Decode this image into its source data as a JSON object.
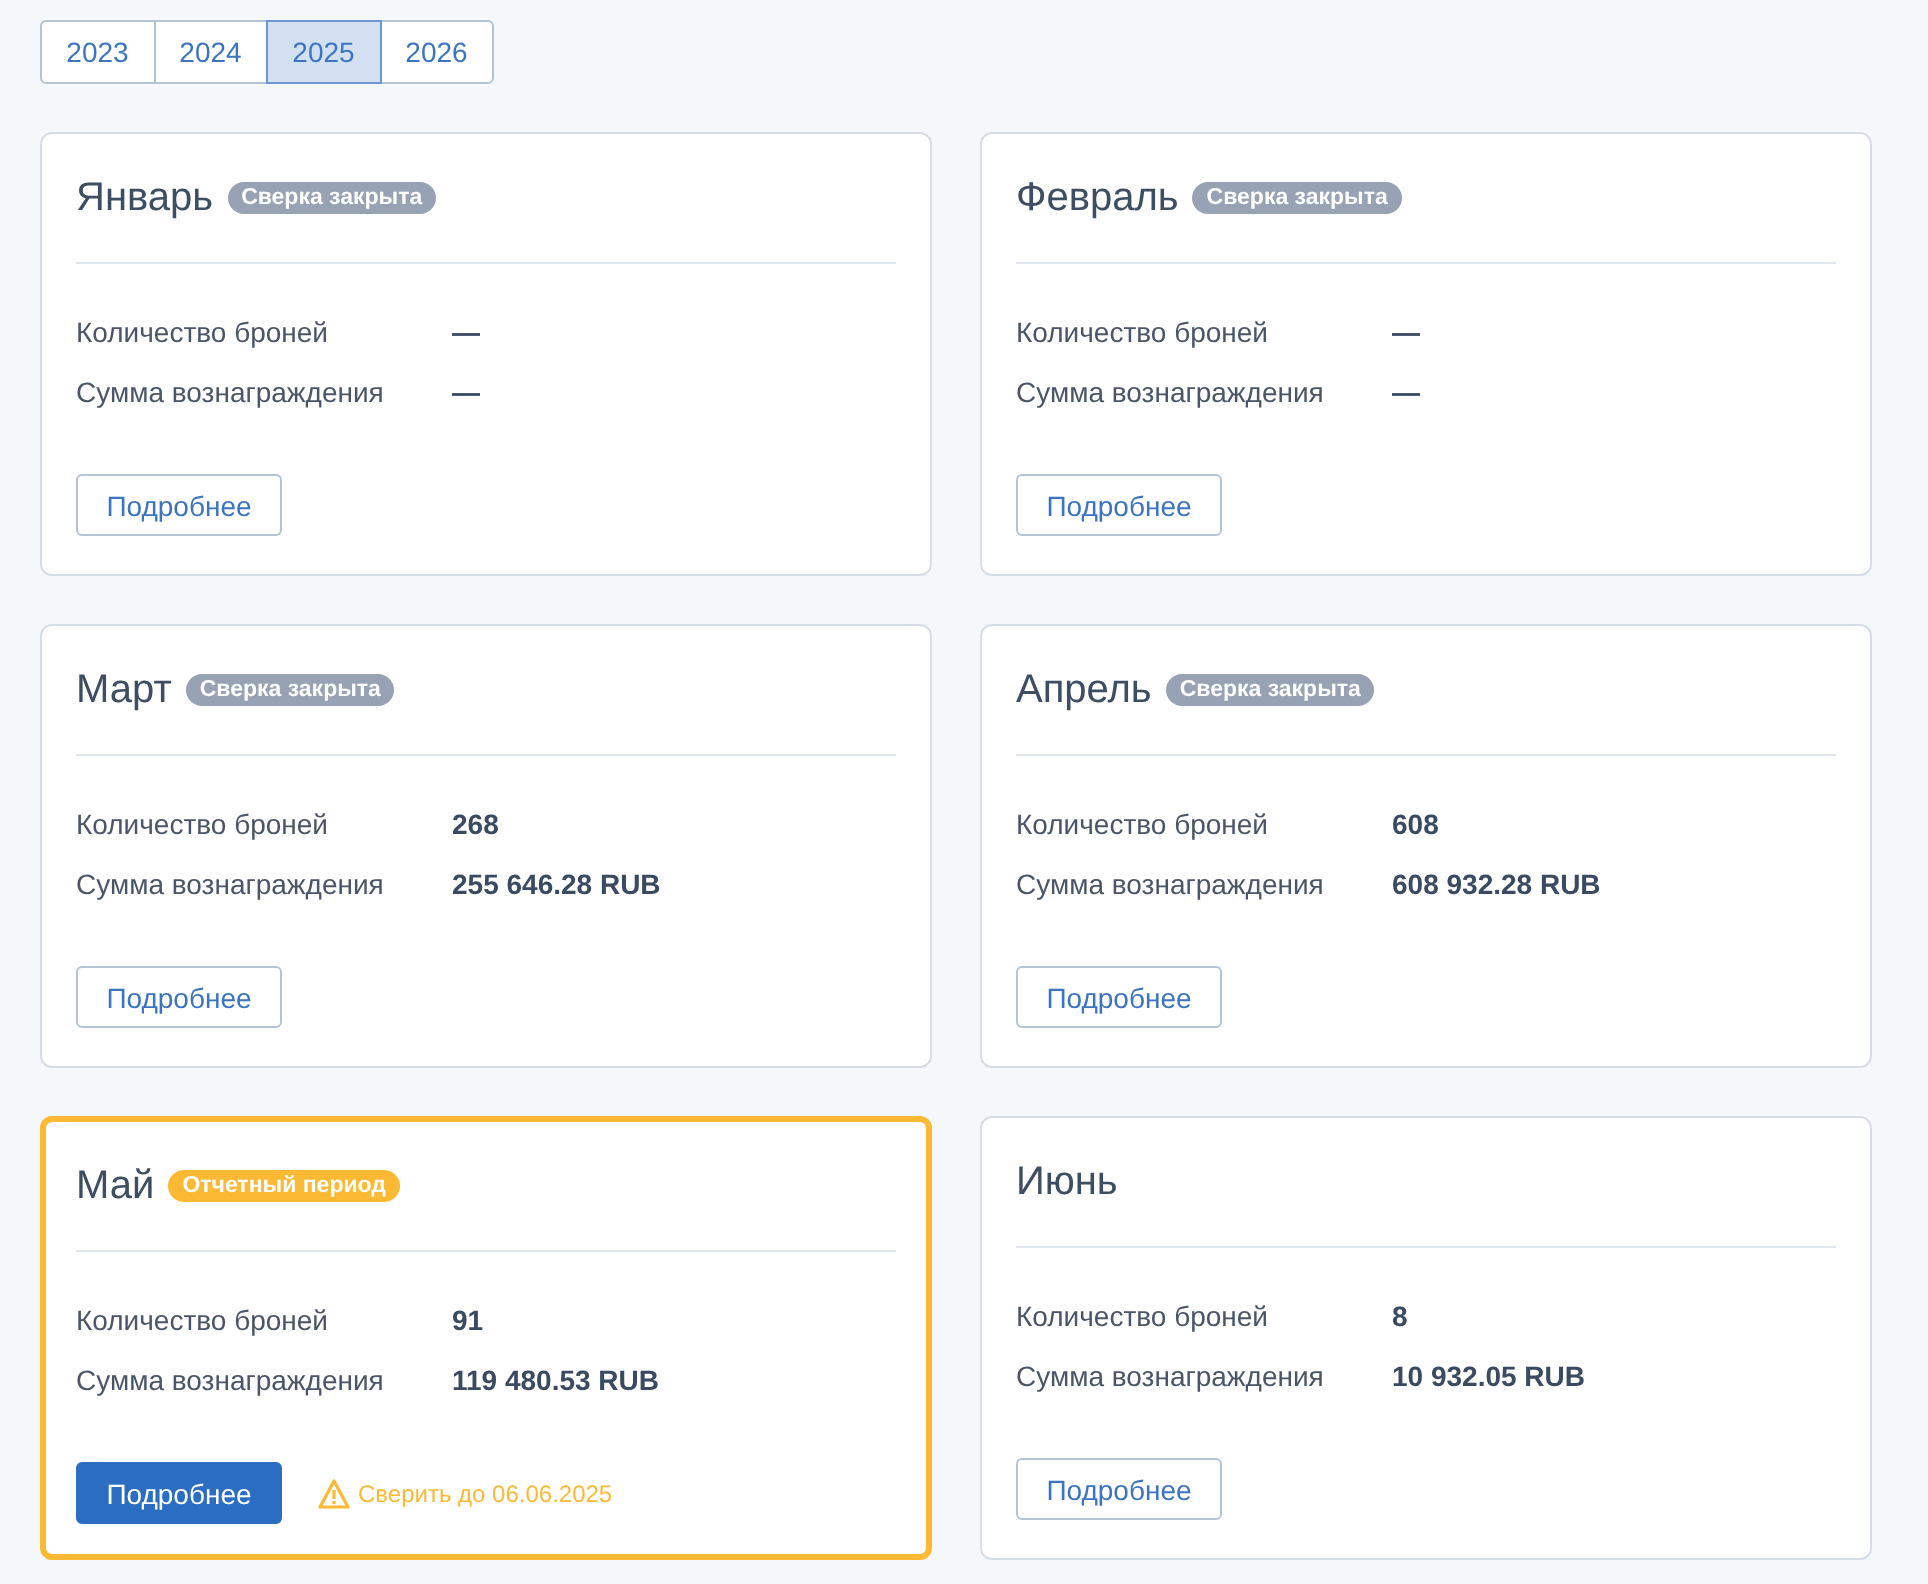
{
  "years": [
    {
      "label": "2023",
      "selected": false
    },
    {
      "label": "2024",
      "selected": false
    },
    {
      "label": "2025",
      "selected": true
    },
    {
      "label": "2026",
      "selected": false
    }
  ],
  "months": [
    {
      "title": "Январь",
      "badge": {
        "kind": "closed",
        "label": "Сверка закрыта"
      },
      "highlighted": false,
      "rows": [
        {
          "label": "Количество броней",
          "value": "—"
        },
        {
          "label": "Сумма вознаграждения",
          "value": "—"
        }
      ],
      "button": {
        "label": "Подробнее",
        "primary": false
      }
    },
    {
      "title": "Февраль",
      "badge": {
        "kind": "closed",
        "label": "Сверка закрыта"
      },
      "highlighted": false,
      "rows": [
        {
          "label": "Количество броней",
          "value": "—"
        },
        {
          "label": "Сумма вознаграждения",
          "value": "—"
        }
      ],
      "button": {
        "label": "Подробнее",
        "primary": false
      }
    },
    {
      "title": "Март",
      "badge": {
        "kind": "closed",
        "label": "Сверка закрыта"
      },
      "highlighted": false,
      "rows": [
        {
          "label": "Количество броней",
          "value": "268"
        },
        {
          "label": "Сумма вознаграждения",
          "value": "255 646.28 RUB"
        }
      ],
      "button": {
        "label": "Подробнее",
        "primary": false
      }
    },
    {
      "title": "Апрель",
      "badge": {
        "kind": "closed",
        "label": "Сверка закрыта"
      },
      "highlighted": false,
      "rows": [
        {
          "label": "Количество броней",
          "value": "608"
        },
        {
          "label": "Сумма вознаграждения",
          "value": "608 932.28 RUB"
        }
      ],
      "button": {
        "label": "Подробнее",
        "primary": false
      }
    },
    {
      "title": "Май",
      "badge": {
        "kind": "current",
        "label": "Отчетный период"
      },
      "highlighted": true,
      "rows": [
        {
          "label": "Количество броней",
          "value": "91"
        },
        {
          "label": "Сумма вознаграждения",
          "value": "119 480.53 RUB"
        }
      ],
      "button": {
        "label": "Подробнее",
        "primary": true
      },
      "warning": "Сверить до 06.06.2025"
    },
    {
      "title": "Июнь",
      "highlighted": false,
      "rows": [
        {
          "label": "Количество броней",
          "value": "8"
        },
        {
          "label": "Сумма вознаграждения",
          "value": "10 932.05 RUB"
        }
      ],
      "button": {
        "label": "Подробнее",
        "primary": false
      }
    }
  ]
}
